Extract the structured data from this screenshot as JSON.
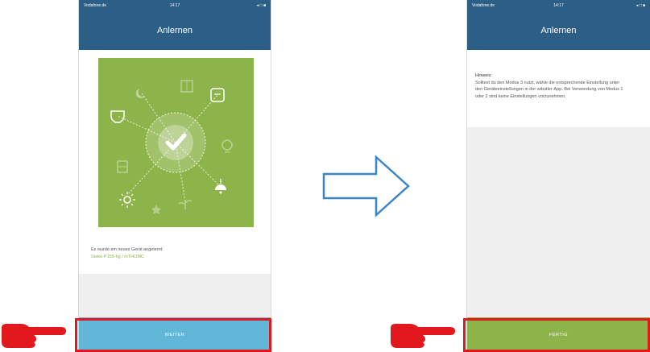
{
  "colors": {
    "header": "#2c5f86",
    "green": "#8db44a",
    "weiter_button": "#62b7d9",
    "highlight_red": "#e2191c",
    "arrow": "#3d86c6"
  },
  "left_screen": {
    "status": {
      "carrier": "Vodafone.de",
      "time": "14:17",
      "icons": "◂ □ ■"
    },
    "title": "Anlernen",
    "illustration_icon": "check-circle-icon",
    "message": "Es wurde ein neues Gerät angelernt:",
    "device_name": "Steko-P155-hg / mTHOMC",
    "button": "WEITER"
  },
  "right_screen": {
    "status": {
      "carrier": "Vodafone.de",
      "time": "14:17",
      "icons": "◂ □ ■"
    },
    "title": "Anlernen",
    "hint_title": "Hinweis:",
    "hint_text": "Solltest du den Modus 3 nutzt, wähle die entsprechende Einstellung unter den Geräteeinstellungen in der wibutler-App. Bei Verwendung von Modus 1 oder 2 sind keine Einstellungen vorzunehmen.",
    "button": "FERTIG"
  },
  "transition_arrow": "right-arrow-icon"
}
